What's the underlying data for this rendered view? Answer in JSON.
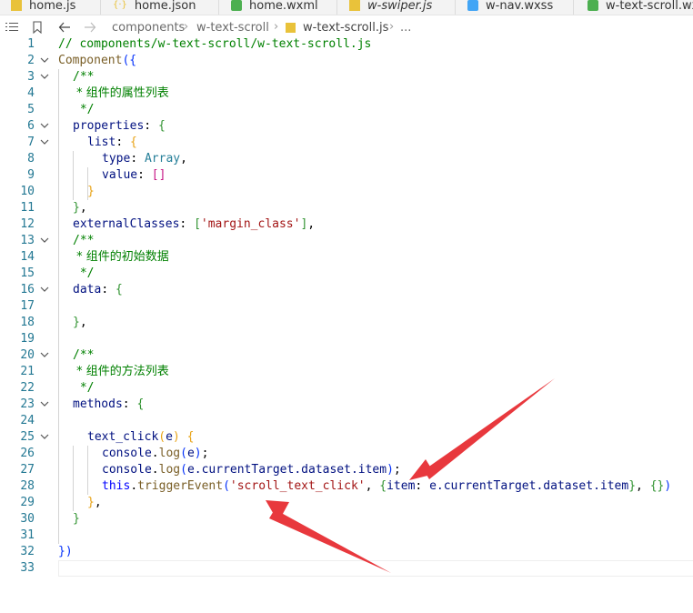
{
  "tabs": [
    {
      "label": "home.js",
      "icon": "js-file-icon"
    },
    {
      "label": "home.json",
      "icon": "json-file-icon"
    },
    {
      "label": "home.wxml",
      "icon": "wxml-file-icon"
    },
    {
      "label": "w-swiper.js",
      "icon": "js-file-icon"
    },
    {
      "label": "w-nav.wxss",
      "icon": "css-file-icon"
    },
    {
      "label": "w-text-scroll.wx",
      "icon": "wxml-file-icon"
    }
  ],
  "toolbar": {
    "list_icon": "list-icon",
    "bookmark_icon": "bookmark-icon",
    "back_icon": "arrow-left-icon",
    "forward_icon": "arrow-right-icon"
  },
  "breadcrumb": {
    "items": [
      "components",
      "w-text-scroll",
      "w-text-scroll.js",
      "..."
    ],
    "file_icon": "js-file-icon"
  },
  "editor": {
    "lines": [
      {
        "n": "1"
      },
      {
        "n": "2"
      },
      {
        "n": "3"
      },
      {
        "n": "4"
      },
      {
        "n": "5"
      },
      {
        "n": "6"
      },
      {
        "n": "7"
      },
      {
        "n": "8"
      },
      {
        "n": "9"
      },
      {
        "n": "10"
      },
      {
        "n": "11"
      },
      {
        "n": "12"
      },
      {
        "n": "13"
      },
      {
        "n": "14"
      },
      {
        "n": "15"
      },
      {
        "n": "16"
      },
      {
        "n": "17"
      },
      {
        "n": "18"
      },
      {
        "n": "19"
      },
      {
        "n": "20"
      },
      {
        "n": "21"
      },
      {
        "n": "22"
      },
      {
        "n": "23"
      },
      {
        "n": "24"
      },
      {
        "n": "25"
      },
      {
        "n": "26"
      },
      {
        "n": "27"
      },
      {
        "n": "28"
      },
      {
        "n": "29"
      },
      {
        "n": "30"
      },
      {
        "n": "31"
      },
      {
        "n": "32"
      },
      {
        "n": "33"
      }
    ],
    "code": {
      "l1": "// components/w-text-scroll/w-text-scroll.js",
      "l2_fn": "Component",
      "l3": "/**",
      "l4": " * 组件的属性列表",
      "l5": " */",
      "l6_key": "properties",
      "l7_key": "list",
      "l8_key": "type",
      "l8_val": "Array",
      "l9_key": "value",
      "l12_key": "externalClasses",
      "l12_str": "'margin_class'",
      "l13": "/**",
      "l14": " * 组件的初始数据",
      "l15": " */",
      "l16_key": "data",
      "l20": "/**",
      "l21": " * 组件的方法列表",
      "l22": " */",
      "l23_key": "methods",
      "l25_fn": "text_click",
      "l25_param": "e",
      "l26_obj": "console",
      "l26_fn": "log",
      "l26_arg": "e",
      "l27_obj": "console",
      "l27_fn": "log",
      "l27_arg": "e.currentTarget.dataset.item",
      "l28_this": "this",
      "l28_fn": "triggerEvent",
      "l28_str": "'scroll_text_click'",
      "l28_key": "item",
      "l28_val": "e.currentTarget.dataset.item"
    }
  },
  "annotation_color": "#e8383d"
}
